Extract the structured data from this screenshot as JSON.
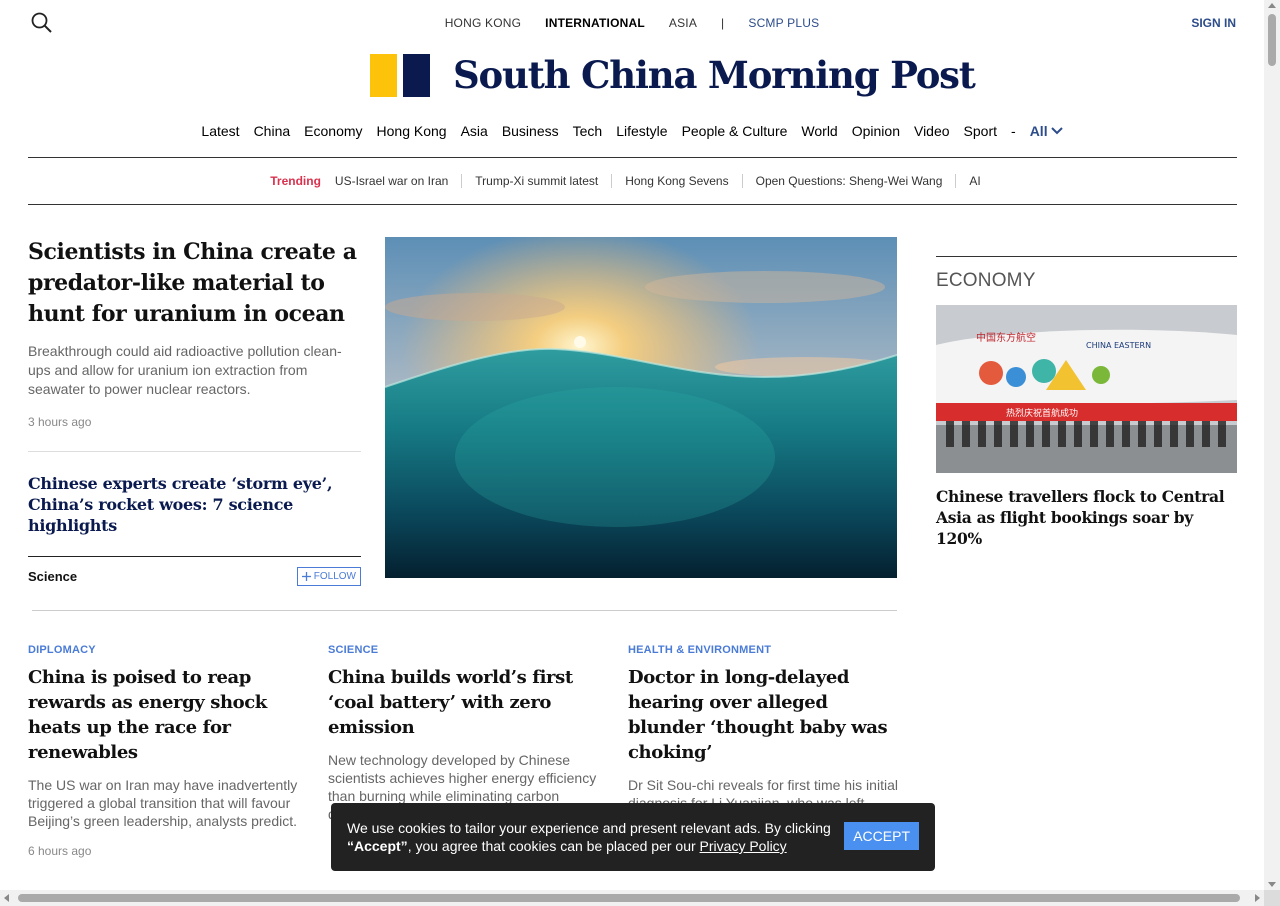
{
  "header": {
    "editions": [
      "HONG KONG",
      "INTERNATIONAL",
      "ASIA"
    ],
    "active_edition": "INTERNATIONAL",
    "separator": "|",
    "plus_label": "SCMP PLUS",
    "sign_in": "SIGN IN",
    "logo_name": "South China Morning Post",
    "logo_colors": {
      "yellow": "#fdc30a",
      "navy": "#0a1a4f"
    }
  },
  "nav": {
    "items": [
      "Latest",
      "China",
      "Economy",
      "Hong Kong",
      "Asia",
      "Business",
      "Tech",
      "Lifestyle",
      "People & Culture",
      "World",
      "Opinion",
      "Video",
      "Sport"
    ],
    "dash": "-",
    "all_label": "All"
  },
  "trending": {
    "label": "Trending",
    "items": [
      "US-Israel war on Iran",
      "Trump-Xi summit latest",
      "Hong Kong Sevens",
      "Open Questions: Sheng-Wei Wang",
      "AI"
    ]
  },
  "lead": {
    "headline": "Scientists in China create a predator-like material to hunt for uranium in ocean",
    "summary": "Breakthrough could aid radioactive pollution clean-ups and allow for uranium ion extraction from seawater to power nuclear reactors.",
    "time": "3 hours ago",
    "related": "Chinese experts create ‘storm eye’, China’s rocket woes: 7 science highlights",
    "topic": "Science",
    "follow_label": "FOLLOW"
  },
  "right": {
    "section": "ECONOMY",
    "headline": "Chinese travellers flock to Central Asia as flight bookings soar by 120%",
    "plane_text": {
      "airline_cn": "中国东方航空",
      "airline_en": "CHINA EASTERN",
      "banner": "热烈庆祝首航成功"
    }
  },
  "cards": [
    {
      "section": "DIPLOMACY",
      "headline": "China is poised to reap rewards as energy shock heats up the race for renewables",
      "summary": "The US war on Iran may have inadvertently triggered a global transition that will favour Beijing’s green leadership, analysts predict.",
      "time": "6 hours ago"
    },
    {
      "section": "SCIENCE",
      "headline": "China builds world’s first ‘coal battery’ with zero emission",
      "summary": "New technology developed by Chinese scientists achieves higher energy efficiency than burning while eliminating carbon dioxide emissions."
    },
    {
      "section": "HEALTH & ENVIRONMENT",
      "headline": "Doctor in long-delayed hearing over alleged blunder ‘thought baby was choking’",
      "summary": "Dr Sit Sou-chi reveals for first time his initial diagnosis for Li Yuanjian, who was left disabled, but parents refuse to accept"
    }
  ],
  "cookie": {
    "text_before": "We use cookies to tailor your experience and present relevant ads. By clicking ",
    "accept_quote": "“Accept”",
    "text_after": ", you agree that cookies can be placed per our ",
    "policy_link": "Privacy Policy",
    "accept_button": "ACCEPT"
  }
}
